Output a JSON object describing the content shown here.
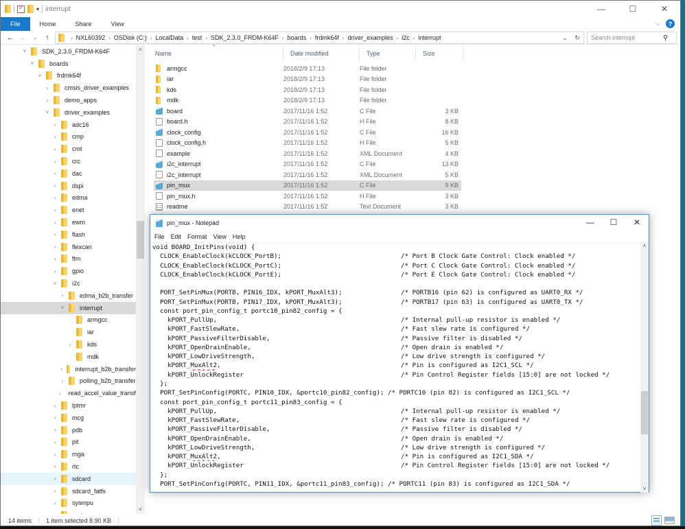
{
  "explorer": {
    "window_title": "interrupt",
    "window_controls": {
      "minimize": "—",
      "maximize": "☐",
      "close": "✕"
    },
    "ribbon_tabs": [
      "File",
      "Home",
      "Share",
      "View"
    ],
    "ribbon_expand_glyph": "⌵",
    "help_glyph": "?",
    "nav_glyphs": {
      "back": "←",
      "forward": "→",
      "recent": "⌄",
      "up": "↑"
    },
    "breadcrumb": [
      "NXL60392",
      "OSDisk (C:)",
      "LocalData",
      "test",
      "SDK_2.3.0_FRDM-K64F",
      "boards",
      "frdmk64f",
      "driver_examples",
      "i2c",
      "interrupt"
    ],
    "breadcrumb_separator": "›",
    "address_dropdown_glyph": "⌄",
    "refresh_glyph": "↻",
    "search": {
      "placeholder": "Search interrupt",
      "value": "",
      "icon": "⚲"
    },
    "nav_tree": [
      {
        "label": "SDK_2.3.0_FRDM-K64F",
        "level": 0,
        "state": "expanded"
      },
      {
        "label": "boards",
        "level": 1,
        "state": "expanded"
      },
      {
        "label": "frdmk64f",
        "level": 2,
        "state": "expanded"
      },
      {
        "label": "cmsis_driver_examples",
        "level": 3,
        "state": "collapsed"
      },
      {
        "label": "demo_apps",
        "level": 3,
        "state": "collapsed"
      },
      {
        "label": "driver_examples",
        "level": 3,
        "state": "expanded"
      },
      {
        "label": "adc16",
        "level": 4,
        "state": "collapsed"
      },
      {
        "label": "cmp",
        "level": 4,
        "state": "collapsed"
      },
      {
        "label": "cmt",
        "level": 4,
        "state": "collapsed"
      },
      {
        "label": "crc",
        "level": 4,
        "state": "collapsed"
      },
      {
        "label": "dac",
        "level": 4,
        "state": "collapsed"
      },
      {
        "label": "dspi",
        "level": 4,
        "state": "collapsed"
      },
      {
        "label": "edma",
        "level": 4,
        "state": "collapsed"
      },
      {
        "label": "enet",
        "level": 4,
        "state": "collapsed"
      },
      {
        "label": "ewm",
        "level": 4,
        "state": "collapsed"
      },
      {
        "label": "flash",
        "level": 4,
        "state": "collapsed"
      },
      {
        "label": "flexcan",
        "level": 4,
        "state": "collapsed"
      },
      {
        "label": "ftm",
        "level": 4,
        "state": "collapsed"
      },
      {
        "label": "gpio",
        "level": 4,
        "state": "collapsed"
      },
      {
        "label": "i2c",
        "level": 4,
        "state": "expanded"
      },
      {
        "label": "edma_b2b_transfer",
        "level": 5,
        "state": "collapsed"
      },
      {
        "label": "interrupt",
        "level": 5,
        "state": "expanded",
        "selected": true
      },
      {
        "label": "armgcc",
        "level": 6,
        "state": "none"
      },
      {
        "label": "iar",
        "level": 6,
        "state": "none"
      },
      {
        "label": "kds",
        "level": 6,
        "state": "collapsed"
      },
      {
        "label": "mdk",
        "level": 6,
        "state": "none"
      },
      {
        "label": "interrupt_b2b_transfer",
        "level": 5,
        "state": "collapsed"
      },
      {
        "label": "polling_b2b_transfer",
        "level": 5,
        "state": "collapsed"
      },
      {
        "label": "read_accel_value_transfer",
        "level": 5,
        "state": "collapsed"
      },
      {
        "label": "lptmr",
        "level": 4,
        "state": "collapsed"
      },
      {
        "label": "mcg",
        "level": 4,
        "state": "collapsed"
      },
      {
        "label": "pdb",
        "level": 4,
        "state": "collapsed"
      },
      {
        "label": "pit",
        "level": 4,
        "state": "collapsed"
      },
      {
        "label": "rnga",
        "level": 4,
        "state": "collapsed"
      },
      {
        "label": "rtc",
        "level": 4,
        "state": "collapsed"
      },
      {
        "label": "sdcard",
        "level": 4,
        "state": "collapsed",
        "hover": true
      },
      {
        "label": "sdcard_fatfs",
        "level": 4,
        "state": "collapsed"
      },
      {
        "label": "sysmpu",
        "level": 4,
        "state": "collapsed"
      },
      {
        "label": "uart",
        "level": 4,
        "state": "collapsed"
      }
    ],
    "columns": [
      "Name",
      "Date modified",
      "Type",
      "Size"
    ],
    "sort_indicator": "^",
    "files": [
      {
        "name": "armgcc",
        "date": "2018/2/9 17:13",
        "type": "File folder",
        "size": "",
        "icon": "folder"
      },
      {
        "name": "iar",
        "date": "2018/2/9 17:13",
        "type": "File folder",
        "size": "",
        "icon": "folder"
      },
      {
        "name": "kds",
        "date": "2018/2/9 17:13",
        "type": "File folder",
        "size": "",
        "icon": "folder"
      },
      {
        "name": "mdk",
        "date": "2018/2/9 17:13",
        "type": "File folder",
        "size": "",
        "icon": "folder"
      },
      {
        "name": "board",
        "date": "2017/11/16 1:52",
        "type": "C File",
        "size": "3 KB",
        "icon": "cfile"
      },
      {
        "name": "board.h",
        "date": "2017/11/16 1:52",
        "type": "H File",
        "size": "8 KB",
        "icon": "hfile"
      },
      {
        "name": "clock_config",
        "date": "2017/11/16 1:52",
        "type": "C File",
        "size": "16 KB",
        "icon": "cfile"
      },
      {
        "name": "clock_config.h",
        "date": "2017/11/16 1:52",
        "type": "H File",
        "size": "5 KB",
        "icon": "hfile"
      },
      {
        "name": "example",
        "date": "2017/11/16 1:52",
        "type": "XML Document",
        "size": "4 KB",
        "icon": "hfile"
      },
      {
        "name": "i2c_interrupt",
        "date": "2017/11/16 1:52",
        "type": "C File",
        "size": "13 KB",
        "icon": "cfile"
      },
      {
        "name": "i2c_interrupt",
        "date": "2017/11/16 1:52",
        "type": "XML Document",
        "size": "5 KB",
        "icon": "hfile"
      },
      {
        "name": "pin_mux",
        "date": "2017/11/16 1:52",
        "type": "C File",
        "size": "9 KB",
        "icon": "cfile",
        "selected": true
      },
      {
        "name": "pin_mux.h",
        "date": "2017/11/16 1:52",
        "type": "H File",
        "size": "3 KB",
        "icon": "hfile"
      },
      {
        "name": "readme",
        "date": "2017/11/16 1:52",
        "type": "Text Document",
        "size": "3 KB",
        "icon": "txt"
      }
    ],
    "status": {
      "item_count": "14 items",
      "selection": "1 item selected  8.90 KB"
    },
    "scroll_glyphs": {
      "up": "˄",
      "down": "˅"
    }
  },
  "notepad": {
    "title": "pin_mux - Notepad",
    "window_controls": {
      "minimize": "—",
      "maximize": "☐",
      "close": "✕"
    },
    "menu": [
      "File",
      "Edit",
      "Format",
      "View",
      "Help"
    ],
    "lines": [
      {
        "code": "void BOARD_InitPins(void) {",
        "comment": ""
      },
      {
        "code": "  CLOCK_EnableClock(kCLOCK_PortB);",
        "comment": "/* Port B Clock Gate Control: Clock enabled */"
      },
      {
        "code": "  CLOCK_EnableClock(kCLOCK_PortC);",
        "comment": "/* Port C Clock Gate Control: Clock enabled */"
      },
      {
        "code": "  CLOCK_EnableClock(kCLOCK_PortE);",
        "comment": "/* Port E Clock Gate Control: Clock enabled */"
      },
      {
        "code": "",
        "comment": ""
      },
      {
        "code": "  PORT_SetPinMux(PORTB, PIN16_IDX, kPORT_MuxAlt3);",
        "comment": "/* PORTB16 (pin 62) is configured as UART0_RX */"
      },
      {
        "code": "  PORT_SetPinMux(PORTB, PIN17_IDX, kPORT_MuxAlt3);",
        "comment": "/* PORTB17 (pin 63) is configured as UART0_TX */"
      },
      {
        "code": "  const port_pin_config_t portc10_pin82_config = {",
        "comment": ""
      },
      {
        "code": "    kPORT_PullUp,",
        "comment": "/* Internal pull-up resistor is enabled */"
      },
      {
        "code": "    kPORT_FastSlewRate,",
        "comment": "/* Fast slew rate is configured */"
      },
      {
        "code": "    kPORT_PassiveFilterDisable,",
        "comment": "/* Passive filter is disabled */"
      },
      {
        "code": "    kPORT_OpenDrainEnable,",
        "comment": "/* Open drain is enabled */"
      },
      {
        "code": "    kPORT_LowDriveStrength,",
        "comment": "/* Low drive strength is configured */"
      },
      {
        "code": "    kPORT_MuxAlt2,",
        "comment": "/* Pin is configured as I2C1_SCL */",
        "annotated": true
      },
      {
        "code": "    kPORT_UnlockRegister",
        "comment": "/* Pin Control Register fields [15:0] are not locked */"
      },
      {
        "code": "  };",
        "comment": ""
      },
      {
        "code": "  PORT_SetPinConfig(PORTC, PIN10_IDX, &portc10_pin82_config);",
        "comment": " /* PORTC10 (pin 82) is configured as I2C1_SCL */",
        "inline": true
      },
      {
        "code": "  const port_pin_config_t portc11_pin83_config = {",
        "comment": ""
      },
      {
        "code": "    kPORT_PullUp,",
        "comment": "/* Internal pull-up resistor is enabled */"
      },
      {
        "code": "    kPORT_FastSlewRate,",
        "comment": "/* Fast slew rate is configured */"
      },
      {
        "code": "    kPORT_PassiveFilterDisable,",
        "comment": "/* Passive filter is disabled */"
      },
      {
        "code": "    kPORT_OpenDrainEnable,",
        "comment": "/* Open drain is enabled */"
      },
      {
        "code": "    kPORT_LowDriveStrength,",
        "comment": "/* Low drive strength is configured */"
      },
      {
        "code": "    kPORT_MuxAlt2,",
        "comment": "/* Pin is configured as I2C1_SDA */",
        "annotated": true
      },
      {
        "code": "    kPORT_UnlockRegister",
        "comment": "/* Pin Control Register fields [15:0] are not locked */"
      },
      {
        "code": "  };",
        "comment": ""
      },
      {
        "code": "  PORT_SetPinConfig(PORTC, PIN11_IDX, &portc11_pin83_config);",
        "comment": " /* PORTC11 (pin 83) is configured as I2C1_SDA */",
        "inline": true
      }
    ],
    "annotation_color": "#e02020"
  }
}
